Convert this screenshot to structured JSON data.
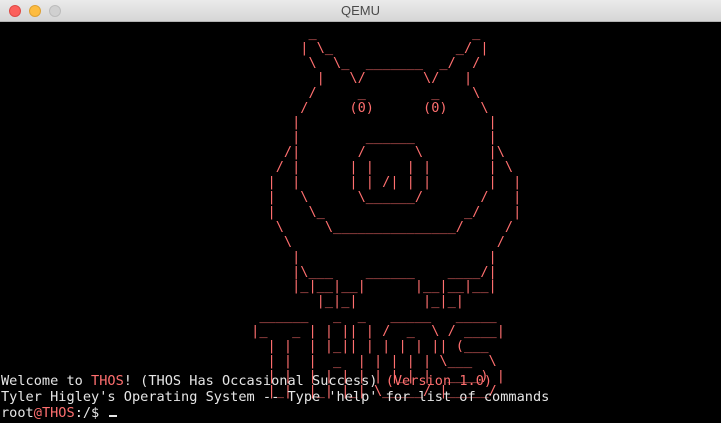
{
  "window": {
    "title": "QEMU"
  },
  "terminal": {
    "ascii_art": "        _                   _\n       | \\_               _/ |\n        \\  \\_  _______  _/  /\n         |   \\/       \\/   |\n        /     _        _    \\\n       /     (0)      (0)    \\\n      |                       |\n      |        ______         |\n     /|       /      \\        |\\\n    / |      | |    | |       | \\\n   |  |      | | /| | |       |  |\n   |   \\      \\______/       /   |\n   |    \\_                 _/    |\n    \\     \\_______________/     /\n     \\                         /\n      |                       |\n      |\\___    ______    ____/|\n      |_|__|__|      |__|__|__|\n         |_|_|        |_|_|\n  ______   _  _   _____   _____\n |_   _ | | || | /  _  \\ / ____|\n   | |  | |_|| | | | | || (___\n   | |  |  _  | | | | | \\___  \\\n   | |  | | | | | |_| |  ____) |\n   |_|  |_| |_| \\_____/ |_____/",
    "welcome_prefix": "Welcome to ",
    "os_name": "THOS",
    "welcome_mid": "! (THOS Has Occasional Success) ",
    "version": "(Version 1.0)",
    "line2": "Tyler Higley's Operating System -- Type 'help' for list of commands",
    "prompt_user": "root",
    "prompt_at": "@",
    "prompt_host": "THOS",
    "prompt_path": ":/$ "
  },
  "colors": {
    "accent_red": "#ff6f6f",
    "text": "#e6e6e6",
    "background": "#000000"
  }
}
